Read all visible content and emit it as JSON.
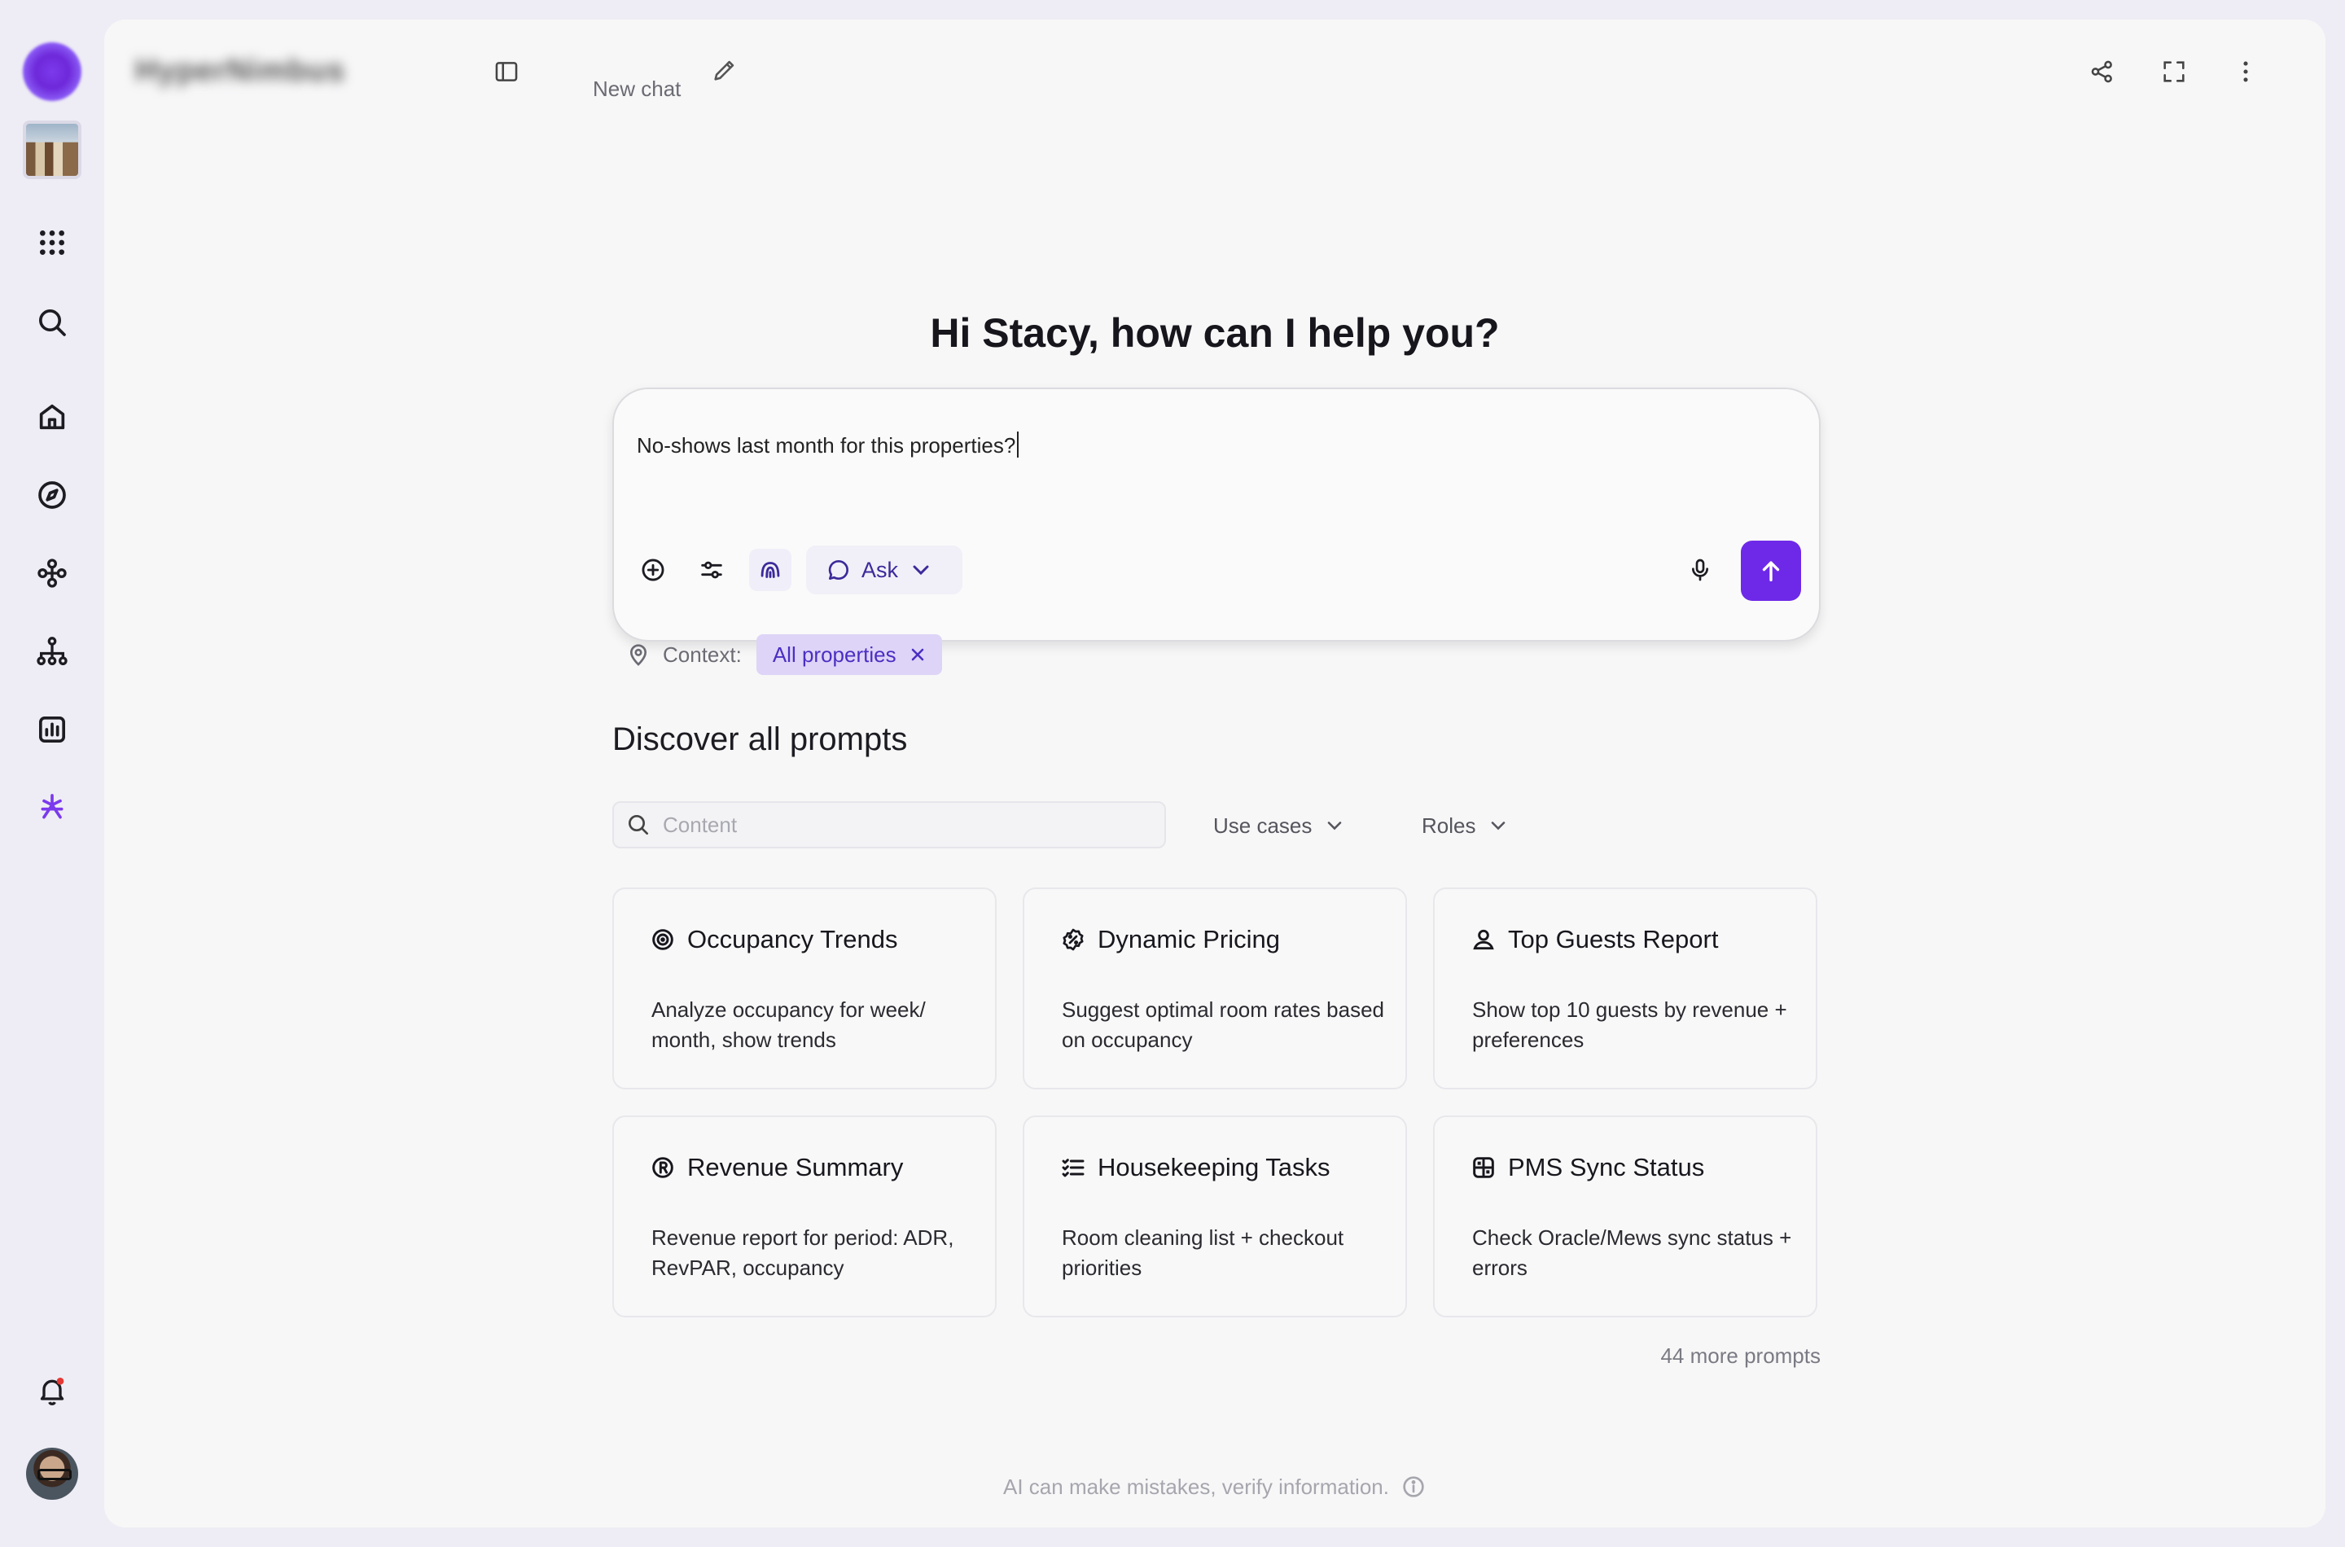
{
  "app": {
    "brand": "HyperNimbus"
  },
  "header": {
    "new_chat_label": "New chat"
  },
  "greeting": "Hi Stacy, how can I help you?",
  "composer": {
    "value": "No-shows last month for this properties?",
    "mode_label": "Ask"
  },
  "context": {
    "label": "Context:",
    "chip": "All properties"
  },
  "discover": {
    "title": "Discover all prompts",
    "search_placeholder": "Content",
    "filters": [
      "Use cases",
      "Roles"
    ],
    "cards": [
      {
        "title": "Occupancy Trends",
        "desc": "Analyze occupancy for week/ month, show trends",
        "icon": "target-icon"
      },
      {
        "title": "Dynamic Pricing",
        "desc": "Suggest optimal room rates based on occupancy",
        "icon": "percent-badge-icon"
      },
      {
        "title": "Top Guests Report",
        "desc": "Show top 10 guests by revenue + preferences",
        "icon": "user-icon"
      },
      {
        "title": "Revenue Summary",
        "desc": "Revenue report for period: ADR, RevPAR, occupancy",
        "icon": "registered-icon"
      },
      {
        "title": "Housekeeping Tasks",
        "desc": "Room cleaning list + checkout priorities",
        "icon": "checklist-icon"
      },
      {
        "title": "PMS Sync Status",
        "desc": "Check Oracle/Mews sync status + errors",
        "icon": "grid-icon"
      }
    ],
    "more_label": "44 more prompts"
  },
  "footer": {
    "disclaimer": "AI can make mistakes, verify information."
  },
  "colors": {
    "accent": "#6d28e8",
    "chip_bg": "#ddd4f7",
    "page_bg": "#eeecf5",
    "panel_bg": "#f7f7f8"
  }
}
